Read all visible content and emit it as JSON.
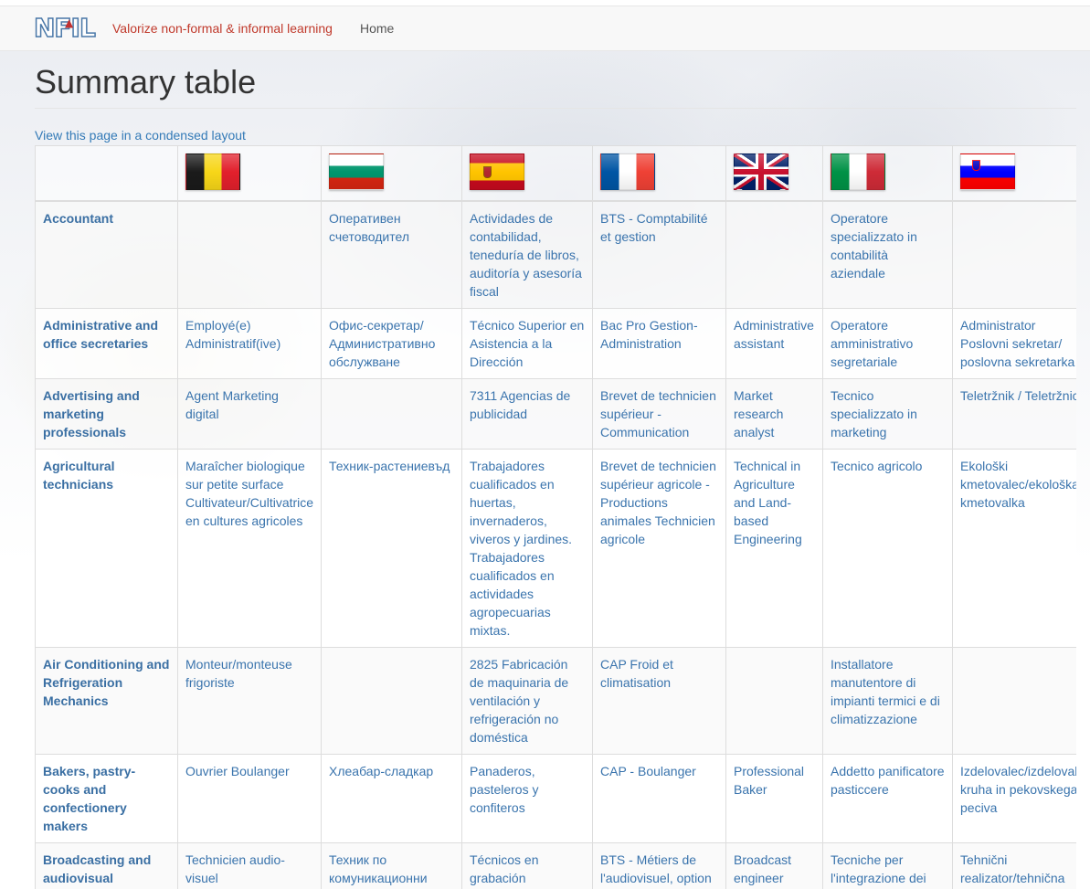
{
  "nav": {
    "logo_text": "NFIL",
    "brand": "Valorize non-formal & informal learning",
    "home": "Home"
  },
  "page": {
    "title": "Summary table",
    "condensed_link": "View this page in a condensed layout"
  },
  "flags": [
    {
      "country": "Belgium",
      "colors": [
        "#1a1a1a",
        "#f7d618",
        "#e2202c"
      ],
      "icon": "belgium-flag-icon"
    },
    {
      "country": "Bulgaria",
      "colors": [
        "#ffffff",
        "#00966e",
        "#d62612"
      ],
      "icon": "bulgaria-flag-icon"
    },
    {
      "country": "Spain",
      "colors": [
        "#c60b1e",
        "#ffc400",
        "#c60b1e"
      ],
      "icon": "spain-flag-icon"
    },
    {
      "country": "France",
      "colors": [
        "#0055a4",
        "#ffffff",
        "#ef4135"
      ],
      "icon": "france-flag-icon"
    },
    {
      "country": "United Kingdom",
      "colors": [
        "#012169",
        "#ffffff",
        "#c8102e"
      ],
      "icon": "uk-flag-icon"
    },
    {
      "country": "Italy",
      "colors": [
        "#009246",
        "#ffffff",
        "#ce2b37"
      ],
      "icon": "italy-flag-icon"
    },
    {
      "country": "Slovenia",
      "colors": [
        "#ffffff",
        "#0000ff",
        "#ff0000"
      ],
      "icon": "slovenia-flag-icon"
    }
  ],
  "rows": [
    {
      "label": "Accountant",
      "cells": [
        "",
        "Оперативен счетоводител",
        "Actividades de contabilidad, teneduría de libros, auditoría y asesoría fiscal",
        "BTS - Comptabilité et gestion",
        "",
        "Operatore specializzato in contabilità aziendale",
        ""
      ]
    },
    {
      "label": "Administrative and office secretaries",
      "cells": [
        "Employé(e) Administratif(ive)",
        "Офис-секретар/ Административно обслужване",
        "Técnico Superior en Asistencia a la Dirección",
        "Bac Pro Gestion-Administration",
        "Administrative assistant",
        "Operatore amministrativo segretariale",
        "Administrator Poslovni sekretar/ poslovna sekretarka"
      ]
    },
    {
      "label": "Advertising and marketing professionals",
      "cells": [
        "Agent Marketing digital",
        "",
        "7311 Agencias de publicidad",
        "Brevet de technicien supérieur - Communication",
        "Market research analyst",
        "Tecnico specializzato in marketing",
        "Teletržnik / Teletržnica"
      ]
    },
    {
      "label": "Agricultural technicians",
      "cells": [
        "Maraîcher biologique sur petite surface Cultivateur/Cultivatrice en cultures agricoles",
        "Техник-растениевъд",
        "Trabajadores cualificados en huertas, invernaderos, viveros y jardines. Trabajadores cualificados en actividades agropecuarias mixtas.",
        "Brevet de technicien supérieur agricole - Productions animales Technicien agricole",
        "Technical in Agriculture and Land-based Engineering",
        "Tecnico agricolo",
        "Ekološki kmetovalec/ekološka kmetovalka"
      ]
    },
    {
      "label": "Air Conditioning and Refrigeration Mechanics",
      "cells": [
        "Monteur/monteuse frigoriste",
        "",
        "2825 Fabricación de maquinaria de ventilación y refrigeración no doméstica",
        "CAP Froid et climatisation",
        "",
        "Installatore manutentore di impianti termici e di climatizzazione",
        ""
      ]
    },
    {
      "label": "Bakers, pastry-cooks and confectionery makers",
      "cells": [
        "Ouvrier Boulanger",
        "Хлеабар-сладкар",
        "Panaderos, pasteleros y confiteros",
        "CAP - Boulanger",
        "Professional Baker",
        "Addetto panificatore pasticcere",
        "Izdelovalec/izdelovalka kruha in pekovskega peciva"
      ]
    },
    {
      "label": "Broadcasting and audiovisual",
      "cells": [
        "Technicien audio-visuel",
        "Техник по комуникационни",
        "Técnicos en grabación",
        "BTS - Métiers de l'audiovisuel, option",
        "Broadcast engineer",
        "Tecniche per l'integrazione dei",
        "Tehnični realizator/tehnična realizatorka medijskih"
      ]
    }
  ]
}
